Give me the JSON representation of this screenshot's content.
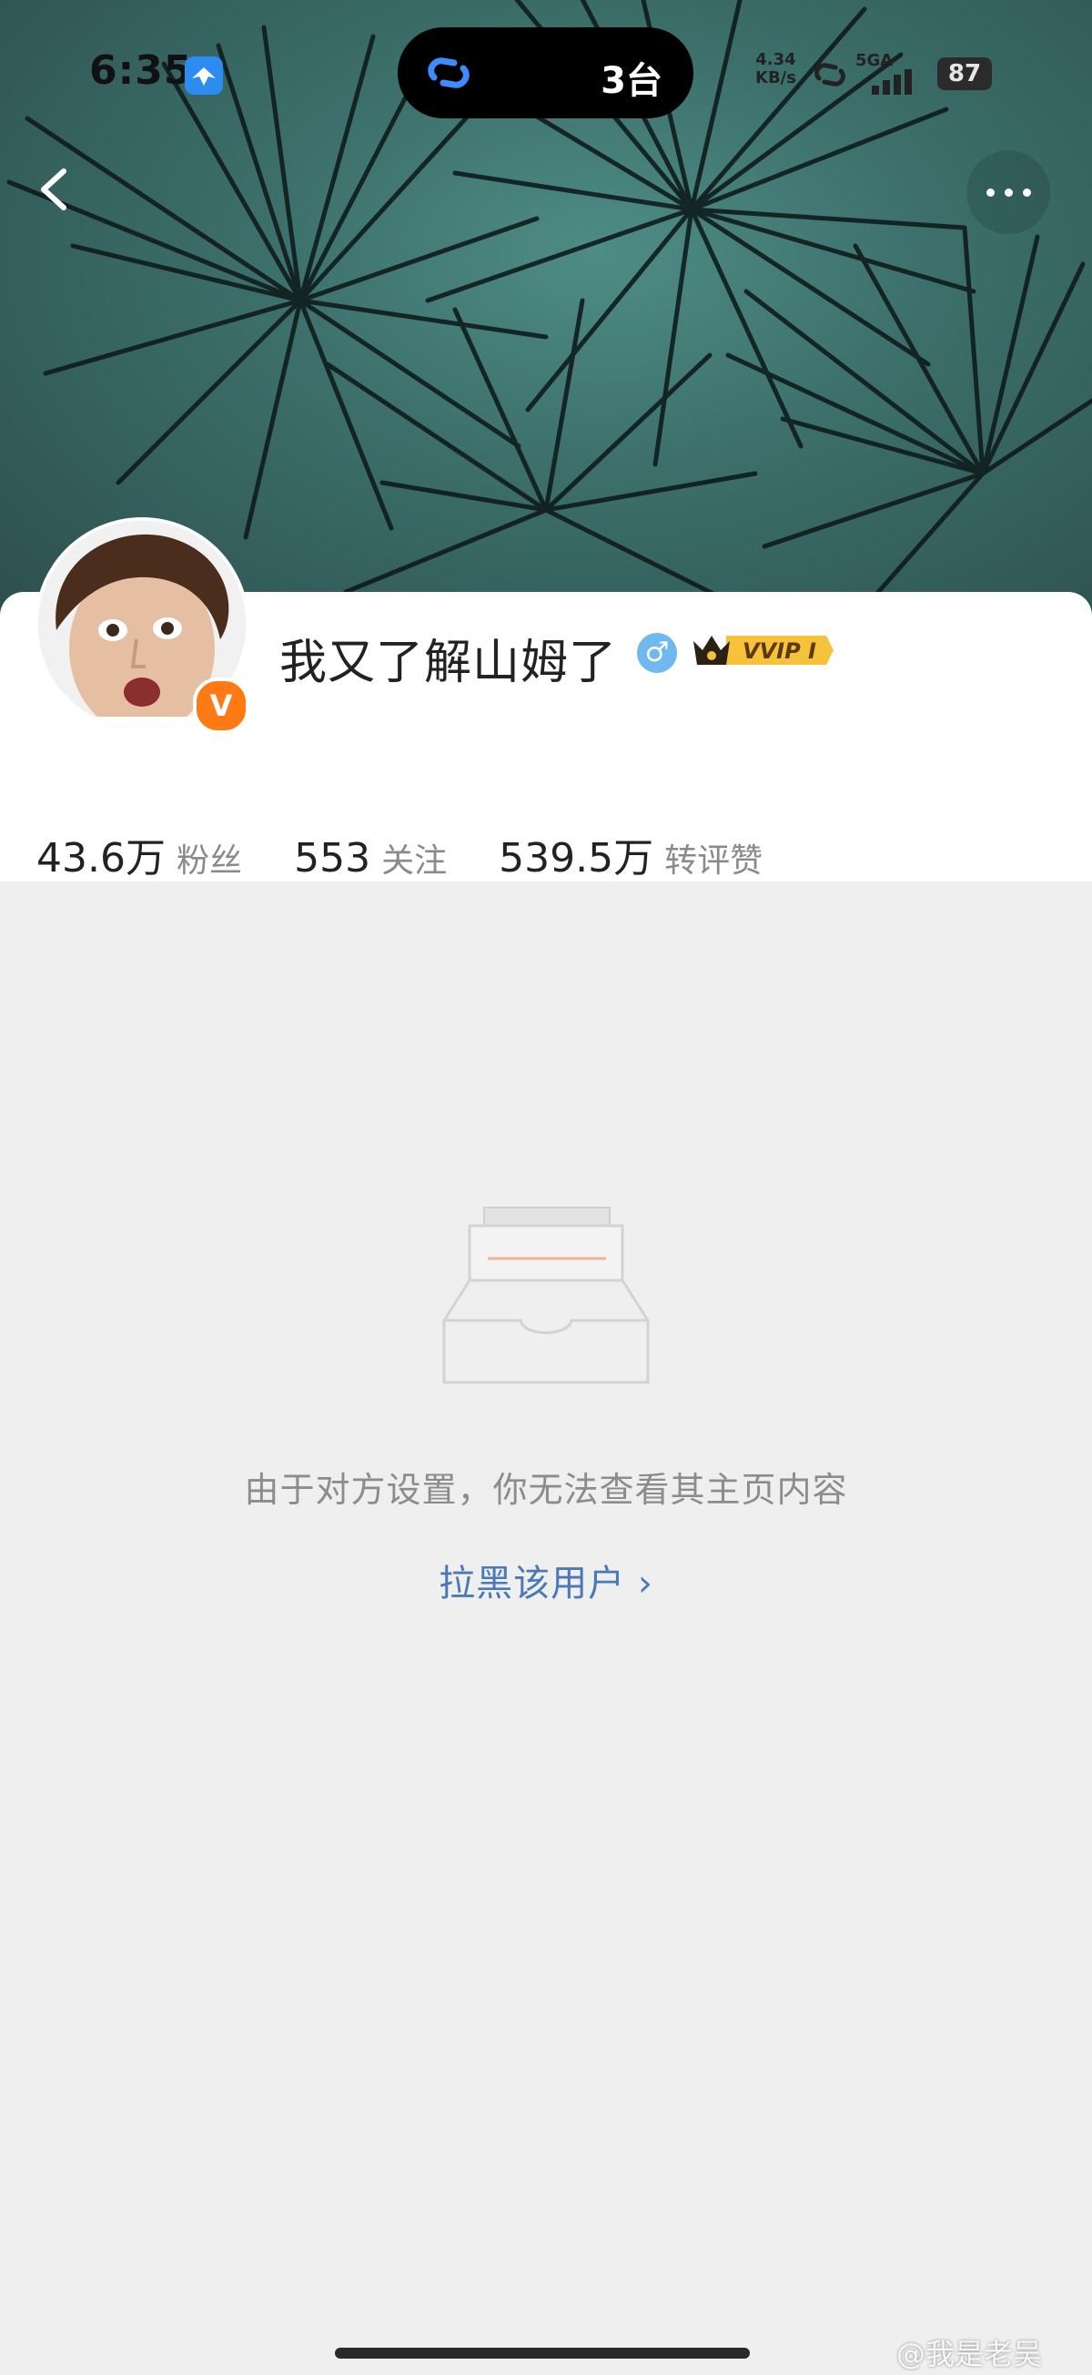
{
  "status_bar": {
    "time": "6:35",
    "island_text": "3台",
    "net_speed_value": "4.34",
    "net_speed_unit": "KB/s",
    "network_type": "5GA",
    "battery": "87"
  },
  "header": {
    "back_icon": "chevron-left-icon",
    "more_icon": "more-horizontal-icon"
  },
  "profile": {
    "username": "我又了解山姆了",
    "verified_badge": "V",
    "gender_symbol": "♂",
    "vip_label": "VVIP I",
    "stats": [
      {
        "value": "43.6万",
        "label": "粉丝"
      },
      {
        "value": "553",
        "label": "关注"
      },
      {
        "value": "539.5万",
        "label": "转评赞"
      }
    ]
  },
  "content": {
    "empty_message": "由于对方设置，你无法查看其主页内容",
    "block_user_link": "拉黑该用户 ›"
  },
  "watermark": "@我是老吴",
  "colors": {
    "accent_orange": "#ff7a14",
    "link_blue": "#4a79b5",
    "cover_teal": "#3c6f6b",
    "page_bg": "#efefef"
  }
}
